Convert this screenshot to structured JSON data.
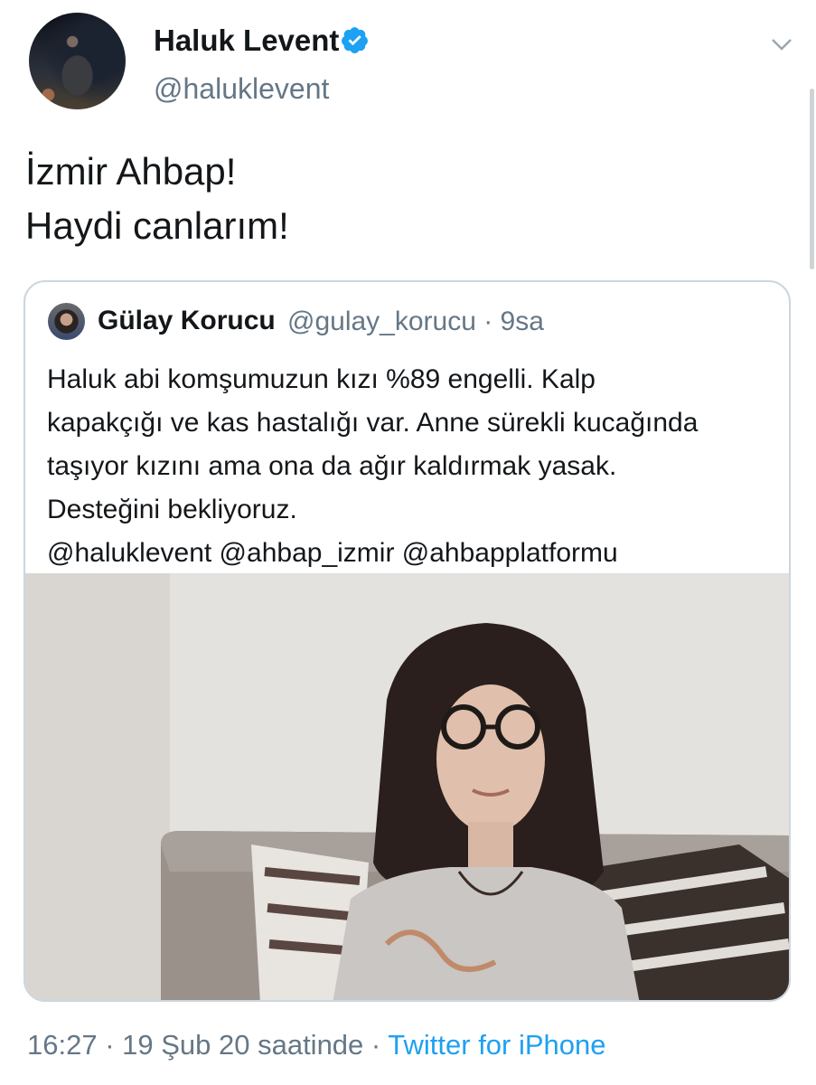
{
  "tweet": {
    "author_name": "Haluk Levent",
    "author_handle": "@haluklevent",
    "text_lines": [
      "İzmir Ahbap!",
      "Haydi canlarım!"
    ],
    "timestamp": "16:27 · 19 Şub 20 saatinde ·",
    "source": "Twitter for iPhone",
    "verified": true,
    "menu_icon": "chevron-down-icon",
    "colors": {
      "text": "#14171a",
      "secondary": "#657786",
      "link": "#1da1f2",
      "verified": "#1da1f2",
      "border": "#ccd6dd"
    }
  },
  "quoted_tweet": {
    "author_name": "Gülay Korucu",
    "meta": "@gulay_korucu · 9sa",
    "text_lines": [
      "Haluk abi komşumuzun kızı %89 engelli. Kalp",
      "kapakçığı ve kas hastalığı var. Anne sürekli kucağında",
      "taşıyor kızını ama ona da ağır kaldırmak yasak.",
      "Desteğini bekliyoruz.",
      "@haluklevent @ahbap_izmir @ahbapplatformu"
    ]
  }
}
